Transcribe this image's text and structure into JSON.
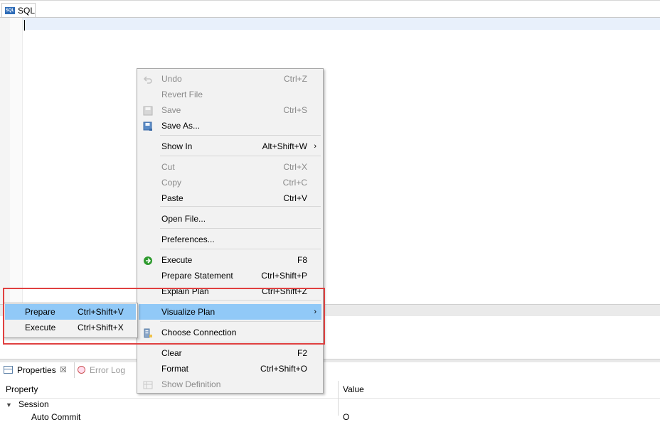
{
  "editor": {
    "tab_label": "SQL",
    "tab_icon": "sql-file-icon"
  },
  "menu": {
    "items": [
      {
        "label": "Undo",
        "shortcut": "Ctrl+Z",
        "enabled": false,
        "icon": "undo-icon"
      },
      {
        "label": "Revert File",
        "shortcut": "",
        "enabled": false
      },
      {
        "label": "Save",
        "shortcut": "Ctrl+S",
        "enabled": false,
        "icon": "save-icon"
      },
      {
        "label": "Save As...",
        "shortcut": "",
        "enabled": true,
        "icon": "save-as-icon"
      },
      {
        "label": "Show In",
        "shortcut": "Alt+Shift+W",
        "enabled": true,
        "submenu": true
      },
      {
        "label": "Cut",
        "shortcut": "Ctrl+X",
        "enabled": false
      },
      {
        "label": "Copy",
        "shortcut": "Ctrl+C",
        "enabled": false
      },
      {
        "label": "Paste",
        "shortcut": "Ctrl+V",
        "enabled": true
      },
      {
        "label": "Open File...",
        "shortcut": "",
        "enabled": true
      },
      {
        "label": "Preferences...",
        "shortcut": "",
        "enabled": true
      },
      {
        "label": "Execute",
        "shortcut": "F8",
        "enabled": true,
        "icon": "execute-icon"
      },
      {
        "label": "Prepare Statement",
        "shortcut": "Ctrl+Shift+P",
        "enabled": true
      },
      {
        "label": "Explain Plan",
        "shortcut": "Ctrl+Shift+Z",
        "enabled": true
      },
      {
        "label": "Visualize Plan",
        "shortcut": "",
        "enabled": true,
        "submenu": true,
        "highlighted": true
      },
      {
        "label": "Choose Connection",
        "shortcut": "",
        "enabled": true,
        "icon": "connection-icon"
      },
      {
        "label": "Clear",
        "shortcut": "F2",
        "enabled": true
      },
      {
        "label": "Format",
        "shortcut": "Ctrl+Shift+O",
        "enabled": true
      },
      {
        "label": "Show Definition",
        "shortcut": "",
        "enabled": false,
        "icon": "definition-icon"
      }
    ],
    "submenu_arrow": "›"
  },
  "submenu": {
    "items": [
      {
        "label": "Prepare",
        "shortcut": "Ctrl+Shift+V",
        "highlighted": true
      },
      {
        "label": "Execute",
        "shortcut": "Ctrl+Shift+X",
        "highlighted": false
      }
    ]
  },
  "properties": {
    "tab_label": "Properties",
    "close_glyph": "☒",
    "error_tab_label": "Error Log",
    "col_property": "Property",
    "col_value": "Value",
    "group_label": "Session",
    "row_label_partial": "Auto Commit",
    "row_value_partial": "O"
  },
  "colors": {
    "highlight": "#91c9f7",
    "annotation": "#e04040",
    "execute_icon": "#2e9a2e"
  }
}
